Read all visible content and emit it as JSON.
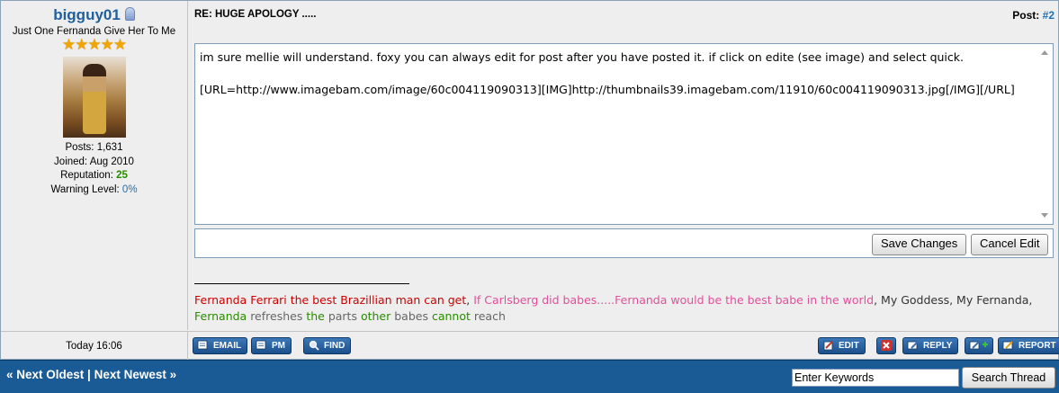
{
  "user": {
    "name": "bigguy01",
    "title": "Just One Fernanda Give Her To Me",
    "rank_stars": 5,
    "posts_label": "Posts:",
    "posts": "1,631",
    "joined_label": "Joined:",
    "joined": "Aug 2010",
    "reputation_label": "Reputation:",
    "reputation": "25",
    "warning_label": "Warning Level:",
    "warning": "0%"
  },
  "post": {
    "title": "RE: HUGE APOLOGY .....",
    "number_label": "Post:",
    "number": "#2",
    "editor_text": "im sure mellie will understand. foxy you can always edit for post after you have posted it. if click on edite (see image) and select quick.\n\n[URL=http://www.imagebam.com/image/60c004119090313][IMG]http://thumbnails39.imagebam.com/11910/60c004119090313.jpg[/IMG][/URL]",
    "save_label": "Save Changes",
    "cancel_label": "Cancel Edit",
    "time": "Today 16:06"
  },
  "signature": {
    "parts": [
      {
        "text": "Fernanda Ferrari the best Brazillian man can get",
        "color": "#cc0000"
      },
      {
        "text": ", ",
        "color": "#333333"
      },
      {
        "text": "If Carlsberg did babes.....Fernanda would be the best babe in the world",
        "color": "#e0509a"
      },
      {
        "text": ", My Goddess, My Fernanda, ",
        "color": "#333333"
      },
      {
        "text": "Fernanda",
        "color": "#2a8a00"
      },
      {
        "text": " refreshes ",
        "color": "#666666"
      },
      {
        "text": "the",
        "color": "#2a8a00"
      },
      {
        "text": " parts ",
        "color": "#666666"
      },
      {
        "text": "other",
        "color": "#2a8a00"
      },
      {
        "text": " babes ",
        "color": "#666666"
      },
      {
        "text": "cannot",
        "color": "#2a8a00"
      },
      {
        "text": " reach",
        "color": "#666666"
      }
    ]
  },
  "post_buttons": {
    "email": "EMAIL",
    "pm": "PM",
    "find": "FIND",
    "edit": "EDIT",
    "reply": "REPLY",
    "report": "REPORT"
  },
  "footer": {
    "next_oldest": "« Next Oldest",
    "separator": "|",
    "next_newest": "Next Newest »",
    "keywords_value": "Enter Keywords",
    "search_label": "Search Thread"
  },
  "colors": {
    "link_blue": "#1f6fb4",
    "footer_bg": "#1a5a95",
    "button_blue": "#2a66a6"
  }
}
